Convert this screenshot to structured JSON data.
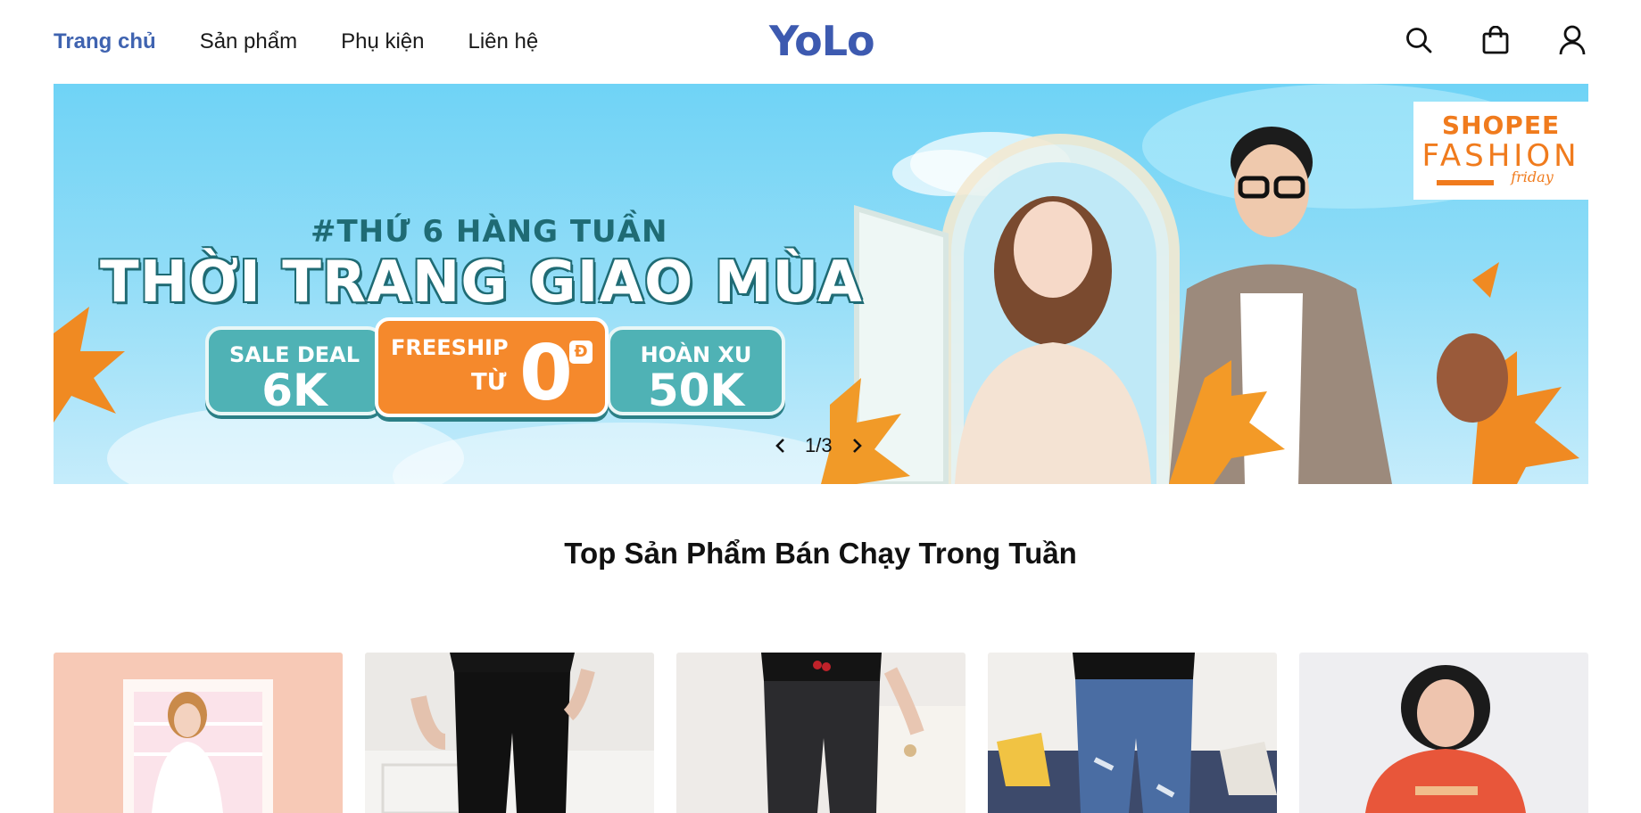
{
  "header": {
    "nav": [
      {
        "label": "Trang chủ",
        "active": true
      },
      {
        "label": "Sản phẩm",
        "active": false
      },
      {
        "label": "Phụ kiện",
        "active": false
      },
      {
        "label": "Liên hệ",
        "active": false
      }
    ],
    "logo": "YoLo",
    "icons": [
      "search-icon",
      "shopping-bag-icon",
      "user-icon"
    ],
    "accent_color": "#3f63b0"
  },
  "banner": {
    "headline_top": "#THỨ 6 HÀNG TUẦN",
    "headline_main": "THỜI TRANG GIAO MÙA",
    "deals": [
      {
        "small": "SALE DEAL",
        "big": "6K"
      },
      {
        "small": "FREESHIP",
        "sub": "TỪ",
        "big": "0",
        "unit": "Đ"
      },
      {
        "small": "HOÀN XU",
        "big": "50K"
      }
    ],
    "brand_tag": {
      "line1": "SHOPEE",
      "line2": "FASHION",
      "line3": "friday"
    },
    "slide_indicator": "1/3",
    "current_slide": 1,
    "total_slides": 3,
    "sky_color": "#6fd3f6",
    "deal_teal": "#4fb2b5",
    "deal_orange": "#f5892c"
  },
  "section": {
    "title": "Top Sản Phẩm Bán Chạy Trong Tuần"
  },
  "products": [
    {
      "name": "product-card-1"
    },
    {
      "name": "product-card-2"
    },
    {
      "name": "product-card-3"
    },
    {
      "name": "product-card-4"
    },
    {
      "name": "product-card-5"
    }
  ]
}
